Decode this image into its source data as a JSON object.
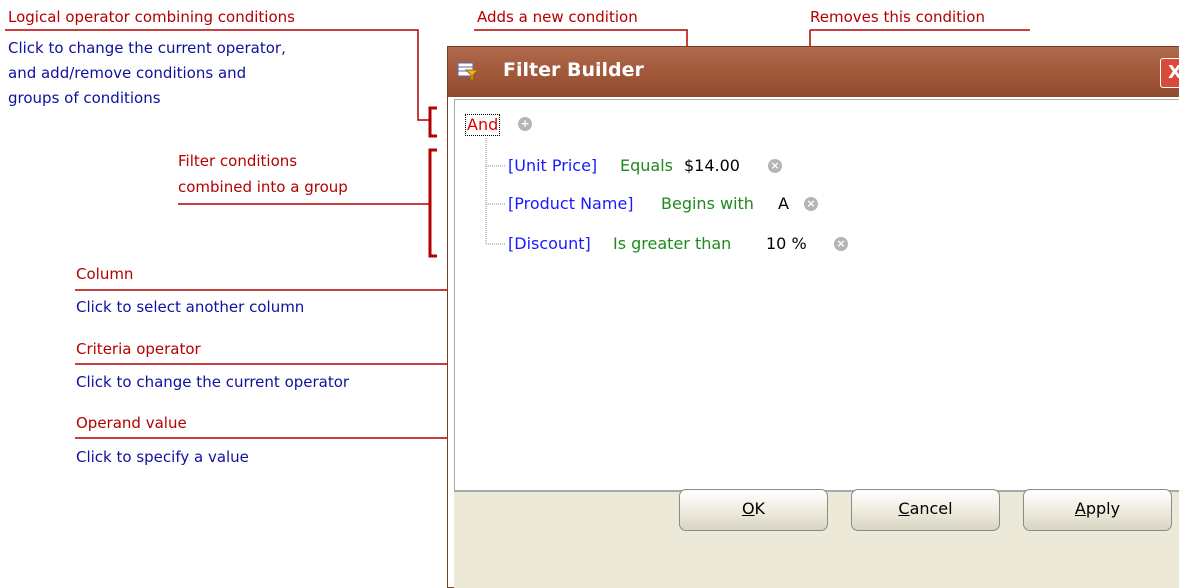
{
  "annotations": {
    "logical_operator": {
      "title": "Logical operator combining conditions",
      "desc_lines": [
        "Click to change the current operator,",
        "and add/remove conditions and",
        "groups of conditions"
      ]
    },
    "add_condition": "Adds a new condition",
    "remove_condition": "Removes this condition",
    "group": [
      "Filter conditions",
      "combined into a group"
    ],
    "column": {
      "title": "Column",
      "desc": "Click to select another column"
    },
    "criteria_operator": {
      "title": "Criteria operator",
      "desc": "Click to change the current operator"
    },
    "operand_value": {
      "title": "Operand value",
      "desc": "Click to specify a value"
    }
  },
  "window": {
    "title": "Filter Builder",
    "close": "X"
  },
  "filter": {
    "group_operator": "And",
    "conditions": [
      {
        "column": "[Unit Price]",
        "operator": "Equals",
        "value": "$14.00"
      },
      {
        "column": "[Product Name]",
        "operator": "Begins with",
        "value": "A"
      },
      {
        "column": "[Discount]",
        "operator": "Is greater than",
        "value": "10 %"
      }
    ]
  },
  "buttons": {
    "ok": {
      "mnemonic": "O",
      "rest": "K"
    },
    "cancel": {
      "mnemonic": "C",
      "rest": "ancel"
    },
    "apply": {
      "mnemonic": "A",
      "rest": "pply"
    }
  },
  "colors": {
    "annotation_red": "#b40000",
    "annotation_blue": "#1010a0",
    "operator_red": "#e00000",
    "column_blue": "#1a1aff",
    "criteria_green": "#1d8a1d",
    "titlebar": "#a45a3c"
  }
}
